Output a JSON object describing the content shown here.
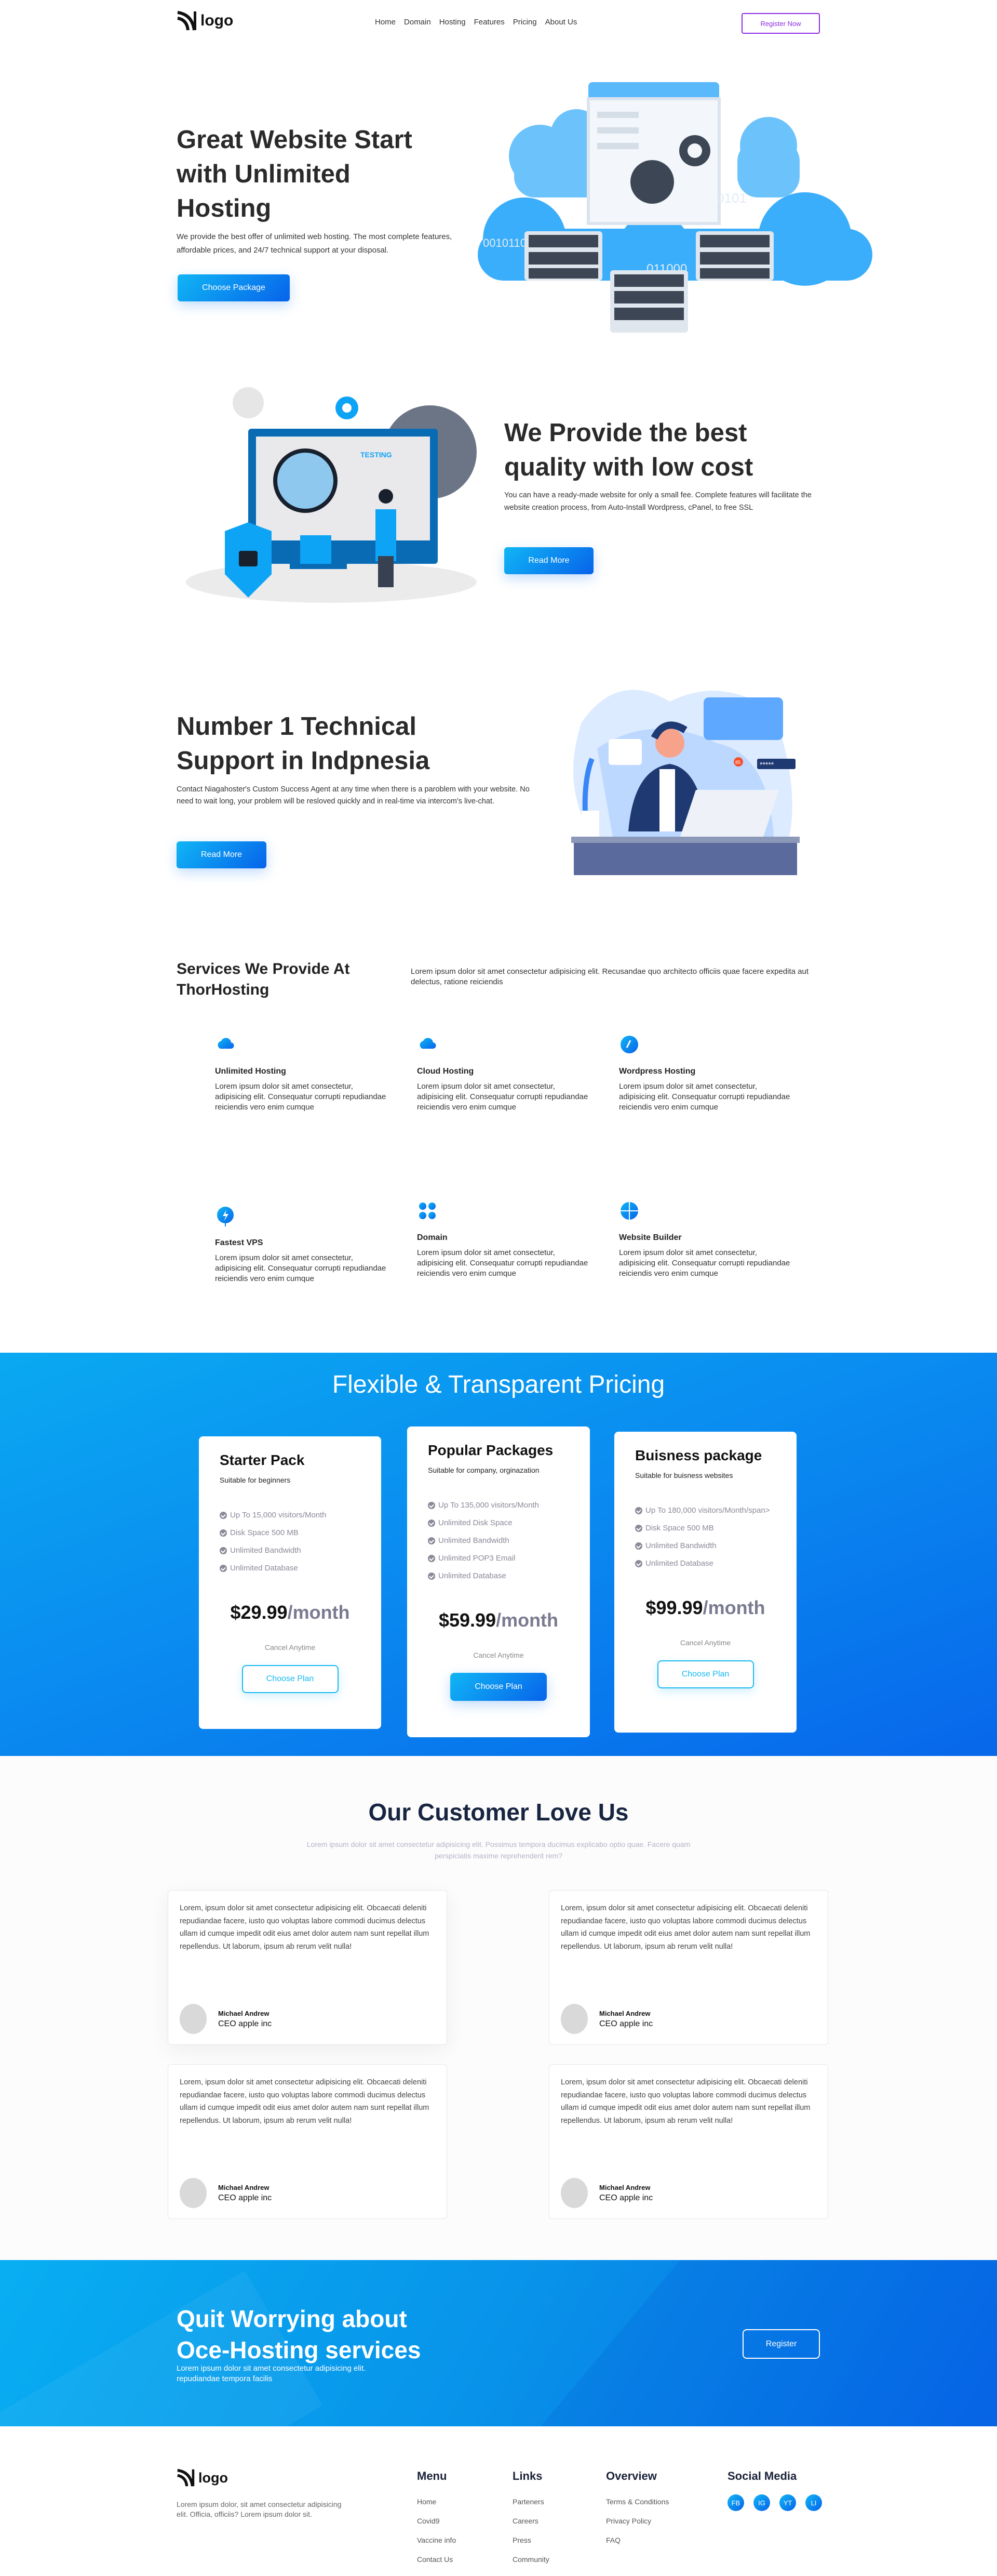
{
  "nav": {
    "logo": "logo",
    "links": [
      "Home",
      "Domain",
      "Hosting",
      "Features",
      "Pricing",
      "About Us"
    ],
    "register": "Register Now"
  },
  "hero": {
    "title_lines": [
      "Great Website Start",
      "with Unlimited",
      "Hosting"
    ],
    "text": "We provide the best offer of unlimited web hosting. The most complete features, affordable prices, and 24/7 technical support at your disposal.",
    "button": "Choose Package",
    "illustration_labels": [
      "0101",
      "001011000101",
      "011000"
    ]
  },
  "quality": {
    "title_lines": [
      "We Provide the best",
      "quality with low cost"
    ],
    "text": "You can have a ready-made website for only a small fee. Complete features will facilitate the website creation process, from Auto-Install Wordpress, cPanel, to free SSL",
    "button": "Read More",
    "illustration_label": "TESTING"
  },
  "support": {
    "title_lines": [
      "Number 1 Technical",
      "Support in Indpnesia"
    ],
    "text": "Contact Niagahoster's Custom Success Agent at any time when there is a paroblem with your website. No need to wait long, your problem will be resloved quickly and in real-time via intercom's live-chat.",
    "button": "Read More",
    "badge": "85",
    "password": "*****"
  },
  "services": {
    "title": "Services We Provide At ThorHosting",
    "text": "Lorem ipsum dolor sit amet consectetur adipisicing elit. Recusandae quo architecto officiis quae facere expedita aut delectus, ratione reiciendis",
    "items": [
      {
        "title": "Unlimited Hosting",
        "icon": "cloud-icon",
        "text": "Lorem ipsum dolor sit amet consectetur, adipisicing elit. Consequatur corrupti repudiandae reiciendis vero enim cumque"
      },
      {
        "title": "Cloud Hosting",
        "icon": "cloud-icon",
        "text": "Lorem ipsum dolor sit amet consectetur, adipisicing elit. Consequatur corrupti repudiandae reiciendis vero enim cumque"
      },
      {
        "title": "Wordpress Hosting",
        "icon": "wordpress-icon",
        "text": "Lorem ipsum dolor sit amet consectetur, adipisicing elit. Consequatur corrupti repudiandae reiciendis vero enim cumque"
      },
      {
        "title": "Fastest VPS",
        "icon": "lightning-icon",
        "text": "Lorem ipsum dolor sit amet consectetur, adipisicing elit. Consequatur corrupti repudiandae reiciendis vero enim cumque"
      },
      {
        "title": "Domain",
        "icon": "grid-icon",
        "text": "Lorem ipsum dolor sit amet consectetur, adipisicing elit. Consequatur corrupti repudiandae reiciendis vero enim cumque"
      },
      {
        "title": "Website Builder",
        "icon": "builder-icon",
        "text": "Lorem ipsum dolor sit amet consectetur, adipisicing elit. Consequatur corrupti repudiandae reiciendis vero enim cumque"
      }
    ]
  },
  "pricing": {
    "title": "Flexible & Transparent Pricing",
    "plans": [
      {
        "name": "Starter Pack",
        "subtitle": "Suitable for beginners",
        "features": [
          "Up To 15,000 visitors/Month",
          "Disk Space 500 MB",
          "Unlimited Bandwidth",
          "Unlimited Database"
        ],
        "price": "$29.99",
        "period": "/month",
        "cancel": "Cancel Anytime",
        "button": "Choose Plan",
        "highlight": false
      },
      {
        "name": "Popular Packages",
        "subtitle": "Suitable for company, orginazation",
        "features": [
          "Up To 135,000 visitors/Month",
          "Unlimited Disk Space",
          "Unlimited Bandwidth",
          "Unlimited POP3 Email",
          "Unlimited Database"
        ],
        "price": "$59.99",
        "period": "/month",
        "cancel": "Cancel Anytime",
        "button": "Choose Plan",
        "highlight": true
      },
      {
        "name": "Buisness package",
        "subtitle": "Suitable for buisness websites",
        "features": [
          "Up To 180,000 visitors/Month/span>",
          "Disk Space 500 MB",
          "Unlimited Bandwidth",
          "Unlimited Database"
        ],
        "price": "$99.99",
        "period": "/month",
        "cancel": "Cancel Anytime",
        "button": "Choose Plan",
        "highlight": false
      }
    ]
  },
  "testimonials": {
    "title": "Our Customer Love Us",
    "subtitle": "Lorem ipsum dolor sit amet consectetur adipisicing elit. Possimus tempora ducimus explicabo optio quae. Facere quam perspiciatis maxime reprehenderit rem?",
    "items": [
      {
        "text": "Lorem, ipsum dolor sit amet consectetur adipisicing elit. Obcaecati deleniti repudiandae facere, iusto quo voluptas labore commodi ducimus delectus ullam id cumque impedit odit eius amet dolor autem nam sunt repellat illum repellendus. Ut laborum, ipsum ab rerum velit nulla!",
        "name": "Michael Andrew",
        "role": "CEO apple inc"
      },
      {
        "text": "Lorem, ipsum dolor sit amet consectetur adipisicing elit. Obcaecati deleniti repudiandae facere, iusto quo voluptas labore commodi ducimus delectus ullam id cumque impedit odit eius amet dolor autem nam sunt repellat illum repellendus. Ut laborum, ipsum ab rerum velit nulla!",
        "name": "Michael Andrew",
        "role": "CEO apple inc"
      },
      {
        "text": "Lorem, ipsum dolor sit amet consectetur adipisicing elit. Obcaecati deleniti repudiandae facere, iusto quo voluptas labore commodi ducimus delectus ullam id cumque impedit odit eius amet dolor autem nam sunt repellat illum repellendus. Ut laborum, ipsum ab rerum velit nulla!",
        "name": "Michael Andrew",
        "role": "CEO apple inc"
      },
      {
        "text": "Lorem, ipsum dolor sit amet consectetur adipisicing elit. Obcaecati deleniti repudiandae facere, iusto quo voluptas labore commodi ducimus delectus ullam id cumque impedit odit eius amet dolor autem nam sunt repellat illum repellendus. Ut laborum, ipsum ab rerum velit nulla!",
        "name": "Michael Andrew",
        "role": "CEO apple inc"
      }
    ]
  },
  "cta": {
    "title_lines": [
      "Quit Worrying about",
      "Oce-Hosting services"
    ],
    "text_lines": [
      "Lorem ipsum dolor sit amet consectetur adipisicing elit.",
      "repudiandae tempora facilis"
    ],
    "button": "Register"
  },
  "footer": {
    "logo": "logo",
    "text": "Lorem ipsum dolor, sit amet consectetur adipisicing elit. Officia, officiis? Lorem ipsum dolor sit.",
    "columns": [
      {
        "title": "Menu",
        "links": [
          "Home",
          "Covid9",
          "Vaccine info",
          "Contact Us"
        ]
      },
      {
        "title": "Links",
        "links": [
          "Parteners",
          "Careers",
          "Press",
          "Community"
        ]
      },
      {
        "title": "Overview",
        "links": [
          "Terms & Conditions",
          "Privacy Policy",
          "FAQ"
        ]
      }
    ],
    "social_title": "Social Media",
    "social": [
      "FB",
      "IG",
      "YT",
      "LI"
    ]
  },
  "colors": {
    "accent": "#0d8ff0",
    "accent_light": "#10b6f5",
    "accent_dark": "#0763ea",
    "register_border": "#8a2be2"
  }
}
